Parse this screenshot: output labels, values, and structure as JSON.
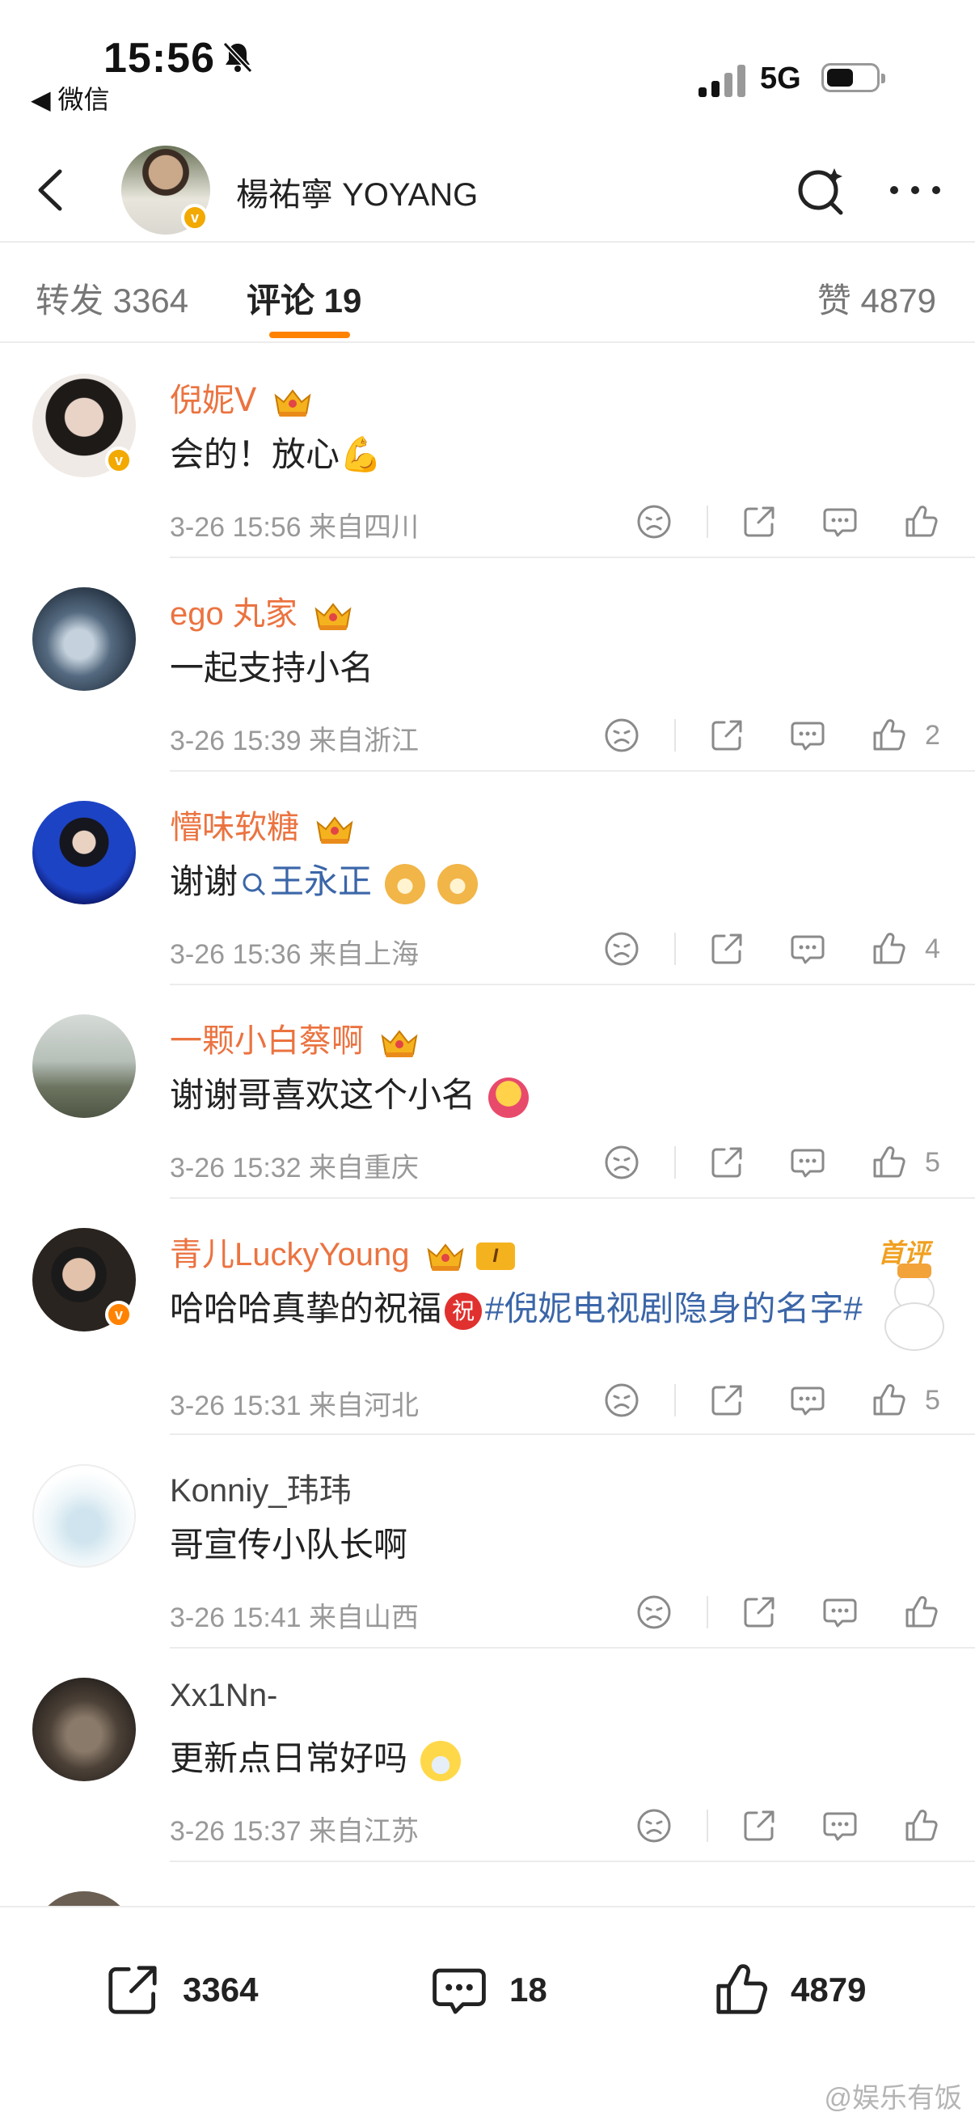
{
  "status_bar": {
    "time": "15:56",
    "back_app_label": "◀ 微信",
    "network": "5G"
  },
  "header": {
    "title": "楊祐寧 YOYANG"
  },
  "tabs": {
    "repost": "转发 3364",
    "comments": "评论 19",
    "likes": "赞 4879"
  },
  "comments": [
    {
      "username": "倪妮Ⅴ",
      "text": "会的！放心💪",
      "meta": "3-26 15:56  来自四川",
      "likes": ""
    },
    {
      "username": "ego 丸家",
      "text": "一起支持小名",
      "meta": "3-26 15:39  来自浙江",
      "likes": "2"
    },
    {
      "username": "懵味软糖",
      "text_prefix": "谢谢",
      "text_mention": "王永正",
      "meta": "3-26 15:36  来自上海",
      "likes": "4"
    },
    {
      "username": "一颗小白蔡啊",
      "text": "谢谢哥喜欢这个小名",
      "meta": "3-26 15:32  来自重庆",
      "likes": "5"
    },
    {
      "username": "青儿LuckyYoung",
      "badge": "首评",
      "text_prefix": "哈哈哈真挚的祝福",
      "text_zhu": "祝",
      "text_hashtag": "#倪妮电视剧隐身的名字#",
      "level": "I",
      "meta": "3-26 15:31  来自河北",
      "likes": "5"
    },
    {
      "username": "Konniy_玮玮",
      "text": "哥宣传小队长啊",
      "meta": "3-26 15:41  来自山西",
      "likes": ""
    },
    {
      "username": "Xx1Nn-",
      "text": "更新点日常好吗",
      "meta": "3-26 15:37  来自江苏",
      "likes": ""
    }
  ],
  "bottom_bar": {
    "repost_count": "3364",
    "comment_count": "18",
    "like_count": "4879"
  },
  "watermark": "@娱乐有饭",
  "colors": {
    "accent": "#ff8200",
    "username_member": "#eb7340",
    "link": "#3b66a8"
  }
}
